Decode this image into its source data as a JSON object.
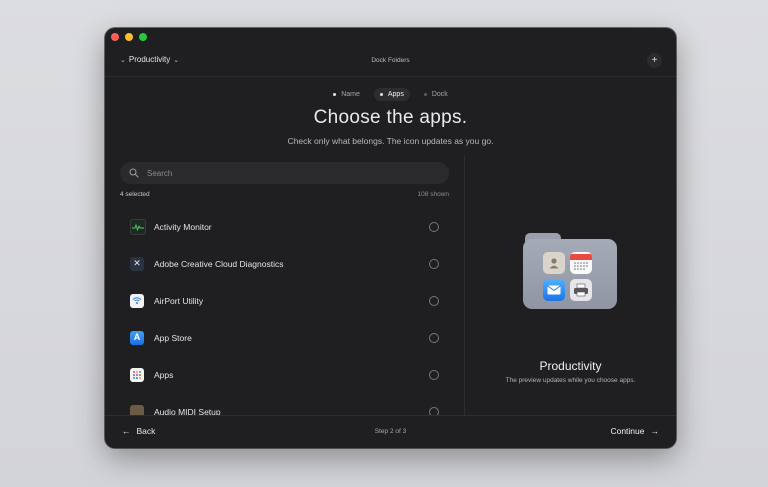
{
  "window": {
    "folder_selector": "Productivity",
    "title": "Dock Folders"
  },
  "steps": [
    {
      "label": "Name",
      "state": "done"
    },
    {
      "label": "Apps",
      "state": "active"
    },
    {
      "label": "Dock",
      "state": "upcoming"
    }
  ],
  "heading": "Choose the apps.",
  "subheading": "Check only what belongs. The icon updates as you go.",
  "search": {
    "placeholder": "Search"
  },
  "counts": {
    "selected": "4 selected",
    "shown": "108 shown"
  },
  "apps": [
    {
      "name": "Activity Monitor",
      "icon": "activity-monitor-icon",
      "checked": false
    },
    {
      "name": "Adobe Creative Cloud Diagnostics",
      "icon": "adobe-diagnostics-icon",
      "checked": false
    },
    {
      "name": "AirPort Utility",
      "icon": "airport-utility-icon",
      "checked": false
    },
    {
      "name": "App Store",
      "icon": "app-store-icon",
      "checked": false
    },
    {
      "name": "Apps",
      "icon": "apps-icon",
      "checked": false
    },
    {
      "name": "Audio MIDI Setup",
      "icon": "audio-midi-icon",
      "checked": false
    }
  ],
  "preview": {
    "title": "Productivity",
    "subtitle": "The preview updates while you choose apps.",
    "icons": [
      "contacts-icon",
      "calendar-icon",
      "mail-icon",
      "printer-icon"
    ]
  },
  "footer": {
    "back": "Back",
    "step": "Step 2 of 3",
    "continue": "Continue"
  }
}
